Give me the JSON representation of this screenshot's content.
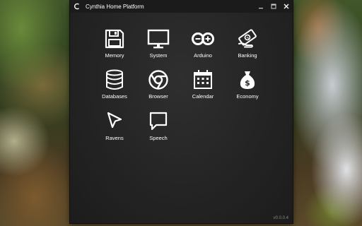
{
  "window": {
    "title": "Cynthia Home Platform",
    "version": "v0.0.0.4",
    "controls": [
      "minimize-icon",
      "maximize-icon",
      "close-icon"
    ]
  },
  "apps": [
    {
      "label": "Memory",
      "icon": "floppy-disk-icon"
    },
    {
      "label": "System",
      "icon": "monitor-icon"
    },
    {
      "label": "Arduino",
      "icon": "arduino-icon"
    },
    {
      "label": "Banking",
      "icon": "money-hand-icon"
    },
    {
      "label": "Databases",
      "icon": "database-icon"
    },
    {
      "label": "Browser",
      "icon": "chrome-icon"
    },
    {
      "label": "Calendar",
      "icon": "calendar-icon"
    },
    {
      "label": "Economy",
      "icon": "money-bag-icon"
    },
    {
      "label": "Ravens",
      "icon": "cursor-arrow-icon"
    },
    {
      "label": "Speech",
      "icon": "speech-bubble-icon"
    }
  ],
  "colors": {
    "window_bg": "#262626",
    "titlebar_bg": "#1b1b1b",
    "text": "#ffffff",
    "version_text": "#888888"
  }
}
